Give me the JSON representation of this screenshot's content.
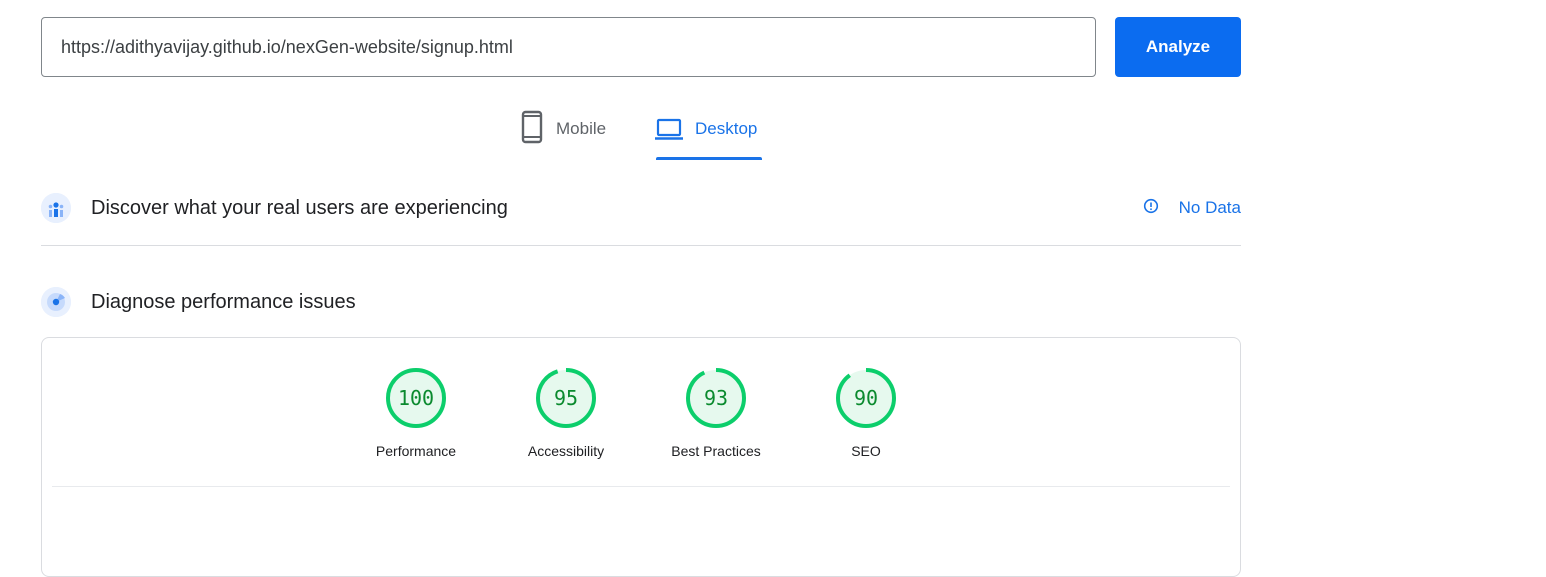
{
  "search": {
    "url": "https://adithyavijay.github.io/nexGen-website/signup.html"
  },
  "analyze_label": "Analyze",
  "tabs": {
    "mobile": "Mobile",
    "desktop": "Desktop"
  },
  "sections": {
    "real_users": {
      "title": "Discover what your real users are experiencing",
      "status": "No Data"
    },
    "diagnose": {
      "title": "Diagnose performance issues"
    }
  },
  "scores": [
    {
      "label": "Performance",
      "value": "100",
      "score": 100
    },
    {
      "label": "Accessibility",
      "value": "95",
      "score": 95
    },
    {
      "label": "Best Practices",
      "value": "93",
      "score": 93
    },
    {
      "label": "SEO",
      "value": "90",
      "score": 90
    }
  ],
  "colors": {
    "accent": "#1a73e8",
    "button": "#0b6cf0",
    "pass_ring": "#0cce6b",
    "pass_fill": "#e6f9ee",
    "pass_text": "#0a8a2e"
  },
  "icons": {
    "mobile": "smartphone-icon",
    "desktop": "laptop-icon",
    "real_users": "crux-users-icon",
    "diagnose": "lighthouse-radar-icon",
    "info": "info-icon"
  }
}
